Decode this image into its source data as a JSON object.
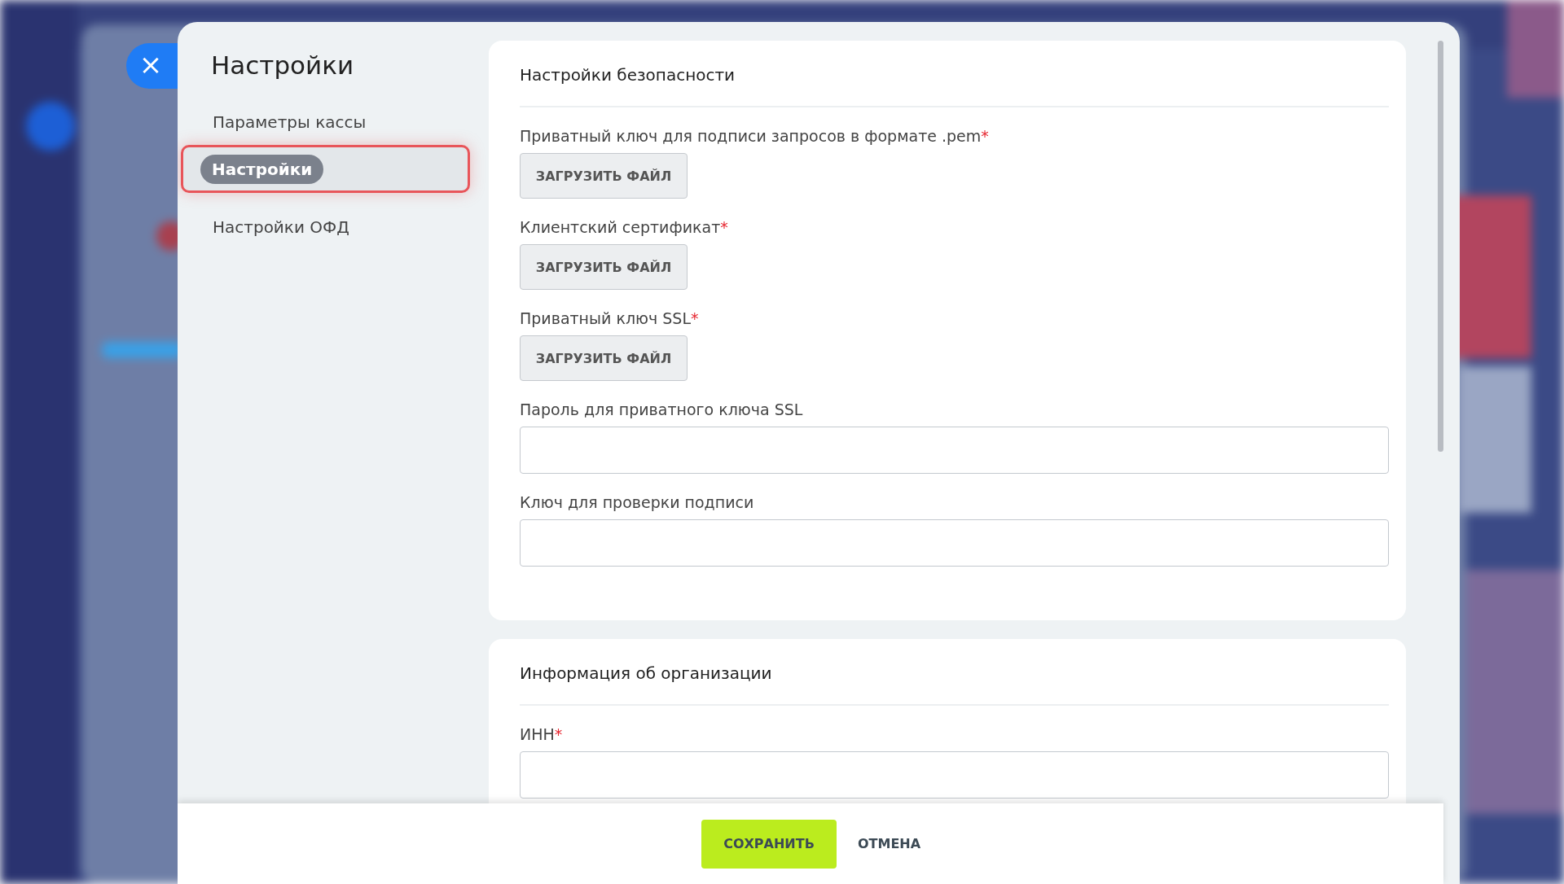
{
  "close_button": {
    "icon": "×"
  },
  "sidebar": {
    "title": "Настройки",
    "items": [
      {
        "label": "Параметры кассы",
        "selected": false
      },
      {
        "label": "Настройки",
        "selected": true
      },
      {
        "label": "Настройки ОФД",
        "selected": false
      }
    ]
  },
  "sections": [
    {
      "title": "Настройки безопасности",
      "fields": [
        {
          "kind": "file",
          "label": "Приватный ключ для подписи запросов в формате .pem",
          "required_mark": "*",
          "button": "ЗАГРУЗИТЬ ФАЙЛ"
        },
        {
          "kind": "file",
          "label": "Клиентский сертификат",
          "required_mark": "*",
          "button": "ЗАГРУЗИТЬ ФАЙЛ"
        },
        {
          "kind": "file",
          "label": "Приватный ключ SSL",
          "required_mark": "*",
          "button": "ЗАГРУЗИТЬ ФАЙЛ"
        },
        {
          "kind": "input",
          "label": "Пароль для приватного ключа SSL"
        },
        {
          "kind": "input",
          "label": "Ключ для проверки подписи"
        }
      ]
    },
    {
      "title": "Информация об организации",
      "fields": [
        {
          "kind": "input",
          "label": "ИНН",
          "required_mark": "*"
        }
      ]
    }
  ],
  "footer": {
    "buttons": [
      {
        "label": "СОХРАНИТЬ",
        "kind": "primary"
      },
      {
        "label": "ОТМЕНА",
        "kind": "link"
      }
    ]
  }
}
